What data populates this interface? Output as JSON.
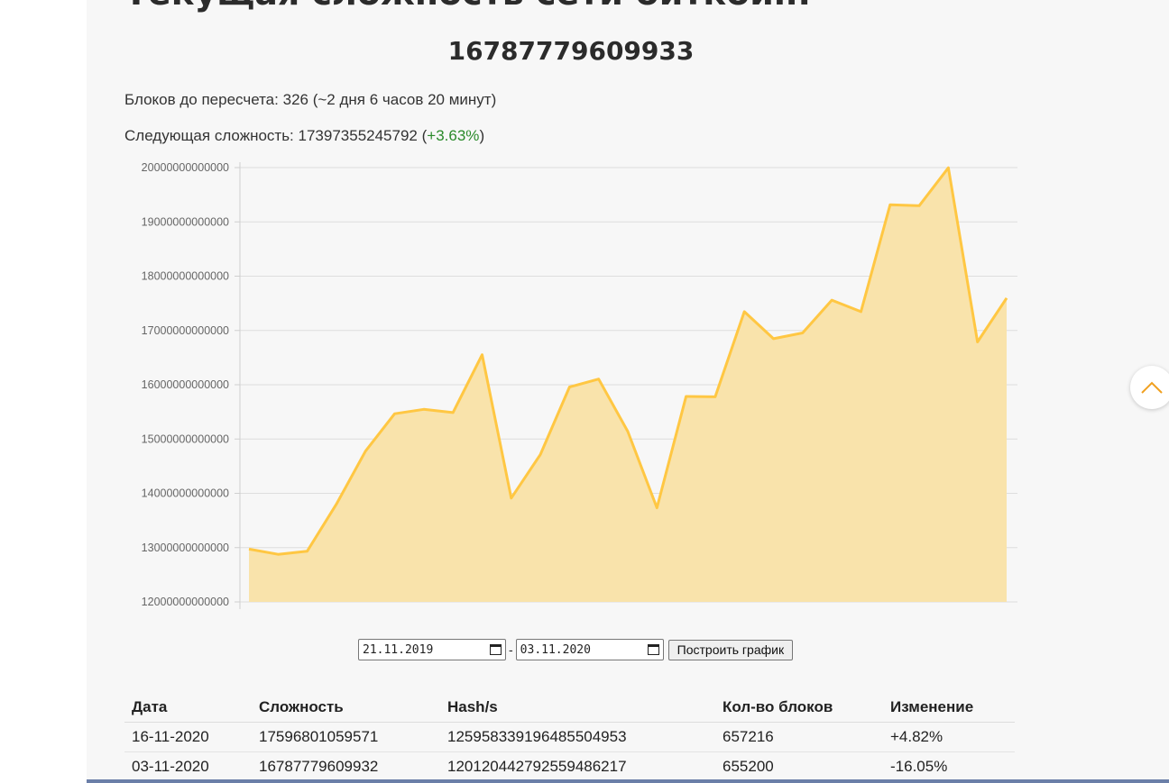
{
  "page": {
    "title": "Текущая сложность сети биткоин:",
    "current_difficulty": "16787779609933"
  },
  "info": {
    "blocks_to_retarget_label": "Блоков до пересчета:",
    "blocks_to_retarget_value": "326 (~2 дня 6 часов 20 минут)",
    "next_difficulty_label": "Следующая сложность:",
    "next_difficulty_value": "17397355245792",
    "next_difficulty_change": "+3.63%"
  },
  "chart_data": {
    "type": "area",
    "x": [
      "2019-11-21",
      "2019-12-04",
      "2019-12-17",
      "2019-12-31",
      "2020-01-13",
      "2020-01-25",
      "2020-02-09",
      "2020-02-22",
      "2020-03-08",
      "2020-03-20",
      "2020-04-03",
      "2020-04-16",
      "2020-04-29",
      "2020-05-13",
      "2020-05-26",
      "2020-06-08",
      "2020-06-20",
      "2020-07-04",
      "2020-07-17",
      "2020-07-30",
      "2020-08-13",
      "2020-08-26",
      "2020-09-08",
      "2020-09-21",
      "2020-10-03",
      "2020-10-17",
      "2020-11-03"
    ],
    "values": [
      12973235968799,
      12876842089682,
      12935252954888,
      13798783827516,
      14776367535688,
      15466098935554,
      15546745765529,
      15486913440292,
      16552923967337,
      13912524048945,
      14715214060656,
      15958652328578,
      16104807485529,
      15138043247082,
      13732352106018,
      15784217546288,
      15776934046512,
      17345948619287,
      16847561611550,
      16953739278300,
      17557993035201,
      17345997805929,
      19314656404097,
      19297683981919,
      19997335994446,
      16787779609932,
      17596801059571
    ],
    "ylim": [
      12000000000000,
      20000000000000
    ],
    "yticks": [
      "20000000000000",
      "19000000000000",
      "18000000000000",
      "17000000000000",
      "16000000000000",
      "15000000000000",
      "14000000000000",
      "13000000000000",
      "12000000000000"
    ],
    "grid": true,
    "colors": {
      "line": "#ffc743",
      "fill": "#f9e3ab"
    }
  },
  "controls": {
    "date_from": "21.11.2019",
    "date_to": "03.11.2020",
    "separator": "-",
    "build_button_label": "Построить график"
  },
  "table": {
    "headers": [
      "Дата",
      "Сложность",
      "Hash/s",
      "Кол-во блоков",
      "Изменение"
    ],
    "rows": [
      {
        "date": "16-11-2020",
        "difficulty": "17596801059571",
        "hashrate": "125958339196485504953",
        "blocks": "657216",
        "change": "+4.82%",
        "change_sign": "pos"
      },
      {
        "date": "03-11-2020",
        "difficulty": "16787779609932",
        "hashrate": "120120442792559486217",
        "blocks": "655200",
        "change": "-16.05%",
        "change_sign": "neg"
      }
    ]
  },
  "icons": {
    "scroll_top": "chevron-up-icon",
    "calendar": "calendar-icon"
  }
}
